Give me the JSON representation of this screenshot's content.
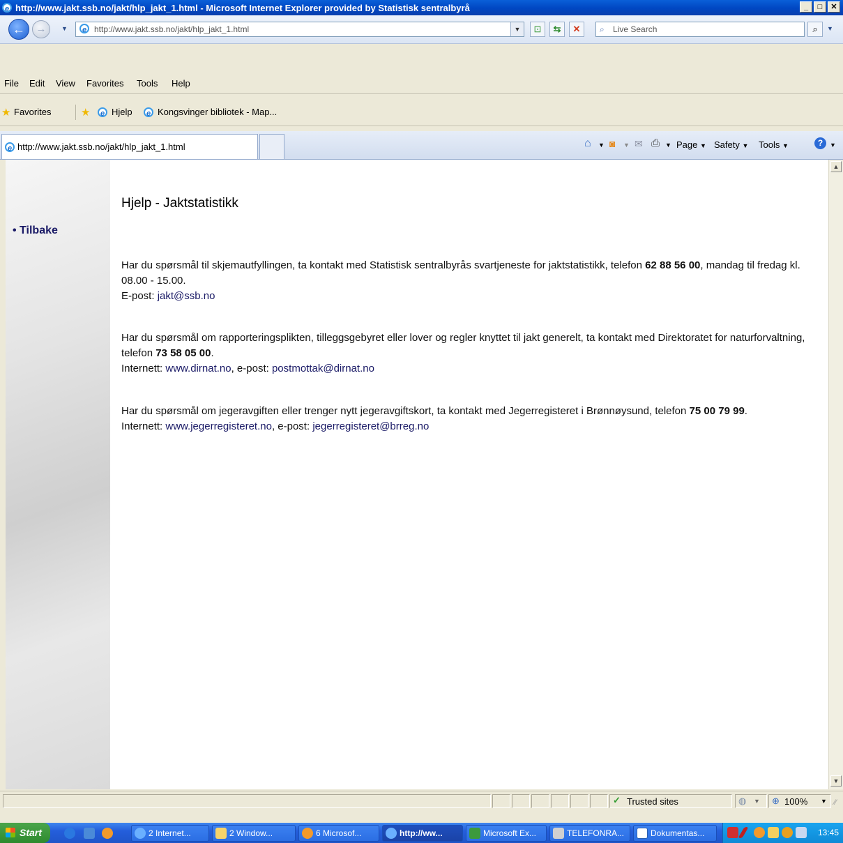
{
  "window": {
    "title": "http://www.jakt.ssb.no/jakt/hlp_jakt_1.html - Microsoft Internet Explorer provided by Statistisk sentralbyrå"
  },
  "address": {
    "url": "http://www.jakt.ssb.no/jakt/hlp_jakt_1.html"
  },
  "search": {
    "placeholder": "Live Search"
  },
  "menu": {
    "file": "File",
    "edit": "Edit",
    "view": "View",
    "favorites": "Favorites",
    "tools": "Tools",
    "help": "Help"
  },
  "favbar": {
    "favorites": "Favorites",
    "item1": "Hjelp",
    "item2": "Kongsvinger bibliotek - Map..."
  },
  "tab": {
    "label": "http://www.jakt.ssb.no/jakt/hlp_jakt_1.html"
  },
  "commands": {
    "page": "Page",
    "safety": "Safety",
    "tools": "Tools"
  },
  "page": {
    "title": "Hjelp - Jaktstatistikk",
    "back_link": "Tilbake",
    "p1": {
      "text_a": "Har du spørsmål til skjemautfyllingen, ta kontakt med Statistisk sentralbyrås svartjeneste for jaktstatistikk, telefon",
      "phone": "62 88 56 00",
      "text_b": ", mandag til fredag kl. 08.00 - 15.00.",
      "email_label": "E-post:",
      "email": "jakt@ssb.no"
    },
    "p2": {
      "text_a": "Har du spørsmål om rapporteringsplikten, tilleggsgebyret eller lover og regler knyttet til jakt generelt, ta kontakt med Direktoratet for naturforvaltning, telefon",
      "phone": "73 58 05 00",
      "text_b": ".",
      "internet_label": "Internett:",
      "internet": "www.dirnat.no",
      "email_label": ", e-post:",
      "email": "postmottak@dirnat.no"
    },
    "p3": {
      "text_a": "Har du spørsmål om jegeravgiften eller trenger nytt jegeravgiftskort, ta kontakt med Jegerregisteret i Brønnøysund, telefon",
      "phone": "75 00 79 99",
      "text_b": ".",
      "internet_label": "Internett:",
      "internet": "www.jegerregisteret.no",
      "email_label": ", e-post:",
      "email": "jegerregisteret@brreg.no"
    }
  },
  "status": {
    "zone": "Trusted sites",
    "zoom": "100%"
  },
  "taskbar": {
    "start": "Start",
    "b1": "2 Internet...",
    "b2": "2 Window...",
    "b3": "6 Microsof...",
    "b4": "http://ww...",
    "b5": "Microsoft Ex...",
    "b6": "TELEFONRA...",
    "b7": "Dokumentas...",
    "clock": "13:45"
  }
}
